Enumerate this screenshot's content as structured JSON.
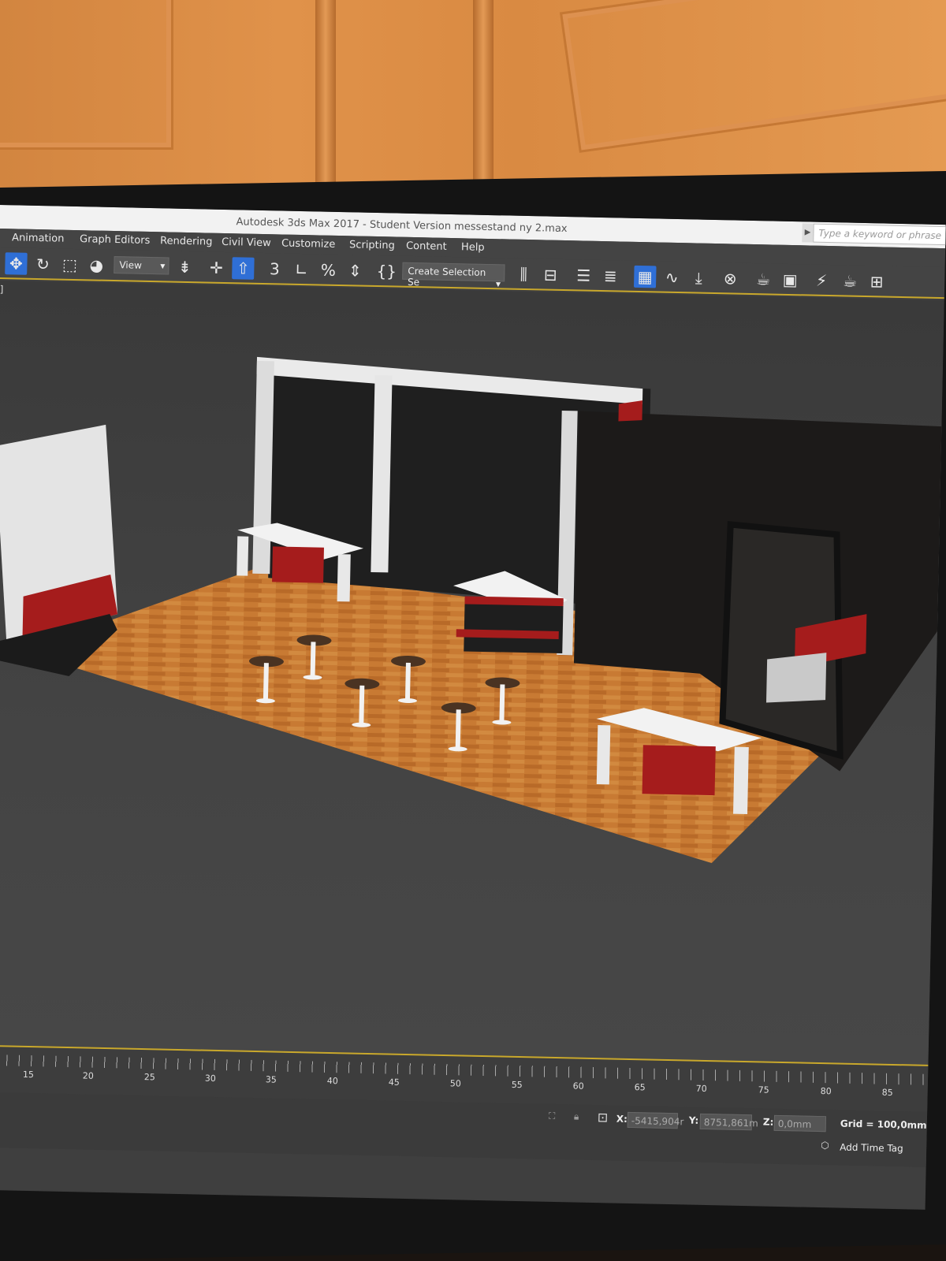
{
  "window": {
    "title": "Autodesk 3ds Max 2017 - Student Version    messestand ny 2.max",
    "search_placeholder": "Type a keyword or phrase"
  },
  "menu": [
    "Animation",
    "Graph Editors",
    "Rendering",
    "Civil View",
    "Customize",
    "Scripting",
    "Content",
    "Help"
  ],
  "toolbar": {
    "reference_coord_system": "View",
    "named_selection_set": "Create Selection Se"
  },
  "viewport": {
    "label": "]"
  },
  "timeline": {
    "ticks": [
      "15",
      "20",
      "25",
      "30",
      "35",
      "40",
      "45",
      "50",
      "55",
      "60",
      "65",
      "70",
      "75",
      "80",
      "85"
    ]
  },
  "status": {
    "x_label": "X:",
    "x_value": "-5415,904r",
    "y_label": "Y:",
    "y_value": "8751,861m",
    "z_label": "Z:",
    "z_value": "0,0mm",
    "grid": "Grid = 100,0mm",
    "add_time_tag": "Add Time Tag"
  },
  "colors": {
    "accent_blue": "#2f6fd6",
    "timeline_gold": "#c9a82c",
    "floor_wood": "#c87a33",
    "booth_red": "#a51c1c"
  }
}
